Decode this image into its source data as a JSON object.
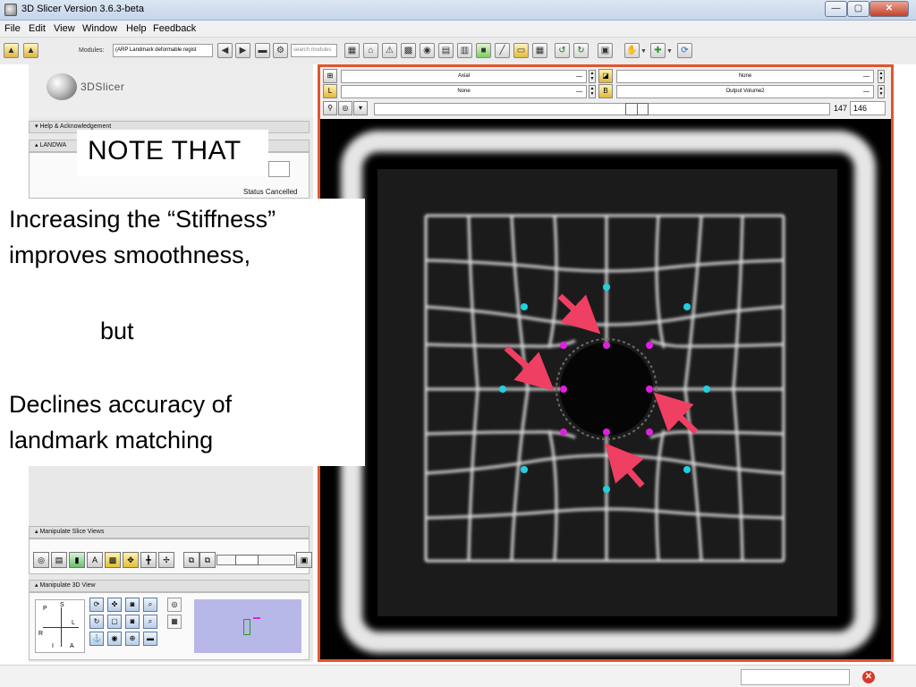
{
  "window": {
    "title": "3D Slicer Version 3.6.3-beta",
    "controls": {
      "minimize": "—",
      "maximize": "▢",
      "close": "✕"
    }
  },
  "menu": [
    "File",
    "Edit",
    "View",
    "Window",
    "Help",
    "Feedback"
  ],
  "toolbar": {
    "modules_label": "Modules:",
    "modules_value": "(ARP Landmark deformable regist",
    "search_placeholder": "search modules"
  },
  "left_panel": {
    "logo_text": "3DSlicer",
    "help_section": "Help & Acknowledgement",
    "module_section": "LANDWA",
    "status_label": "Status",
    "status_value": "Cancelled",
    "manipulate_slice": "Manipulate Slice Views",
    "manipulate_3d": "Manipulate 3D View",
    "orientation": {
      "p": "P",
      "s": "S",
      "l": "L",
      "r": "R",
      "i": "I",
      "a": "A"
    }
  },
  "overlay": {
    "note": "NOTE THAT",
    "line1": "Increasing the “Stiffness”",
    "line2": "improves smoothness,",
    "line3": "but",
    "line4": "Declines accuracy of",
    "line5": "landmark matching"
  },
  "viewer": {
    "orientation_value": "Axial",
    "foreground_value": "None",
    "label_value": "None",
    "background_value": "Output Volume2",
    "slice_value": "147",
    "slice_input": "146"
  },
  "colors": {
    "viewer_border": "#e0562f",
    "landmark_fixed": "#e020e0",
    "landmark_moving": "#20d0e0",
    "arrow": "#ef3f62"
  }
}
